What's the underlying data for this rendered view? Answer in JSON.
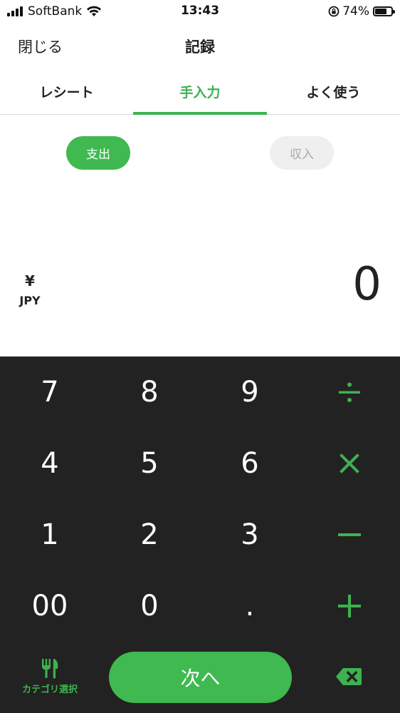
{
  "status_bar": {
    "carrier": "SoftBank",
    "time": "13:43",
    "battery_percent": "74%",
    "battery_level": 0.74
  },
  "header": {
    "close_label": "閉じる",
    "title": "記録"
  },
  "tabs": [
    {
      "label": "レシート",
      "active": false
    },
    {
      "label": "手入力",
      "active": true
    },
    {
      "label": "よく使う",
      "active": false
    }
  ],
  "type_toggle": {
    "expense_label": "支出",
    "income_label": "収入",
    "selected": "expense"
  },
  "amount": {
    "currency_symbol": "¥",
    "currency_code": "JPY",
    "value": "0"
  },
  "keypad": {
    "rows": [
      [
        "7",
        "8",
        "9"
      ],
      [
        "4",
        "5",
        "6"
      ],
      [
        "1",
        "2",
        "3"
      ],
      [
        "00",
        "0",
        "."
      ]
    ],
    "operators": [
      "divide-icon",
      "multiply-icon",
      "minus-icon",
      "plus-icon"
    ]
  },
  "bottom_bar": {
    "category_label": "カテゴリ選択",
    "category_icon": "fork-knife-icon",
    "next_label": "次へ",
    "backspace_icon": "backspace-icon"
  },
  "colors": {
    "accent": "#3db24f",
    "keypad_bg": "#222222",
    "inactive_pill": "#efefef"
  }
}
